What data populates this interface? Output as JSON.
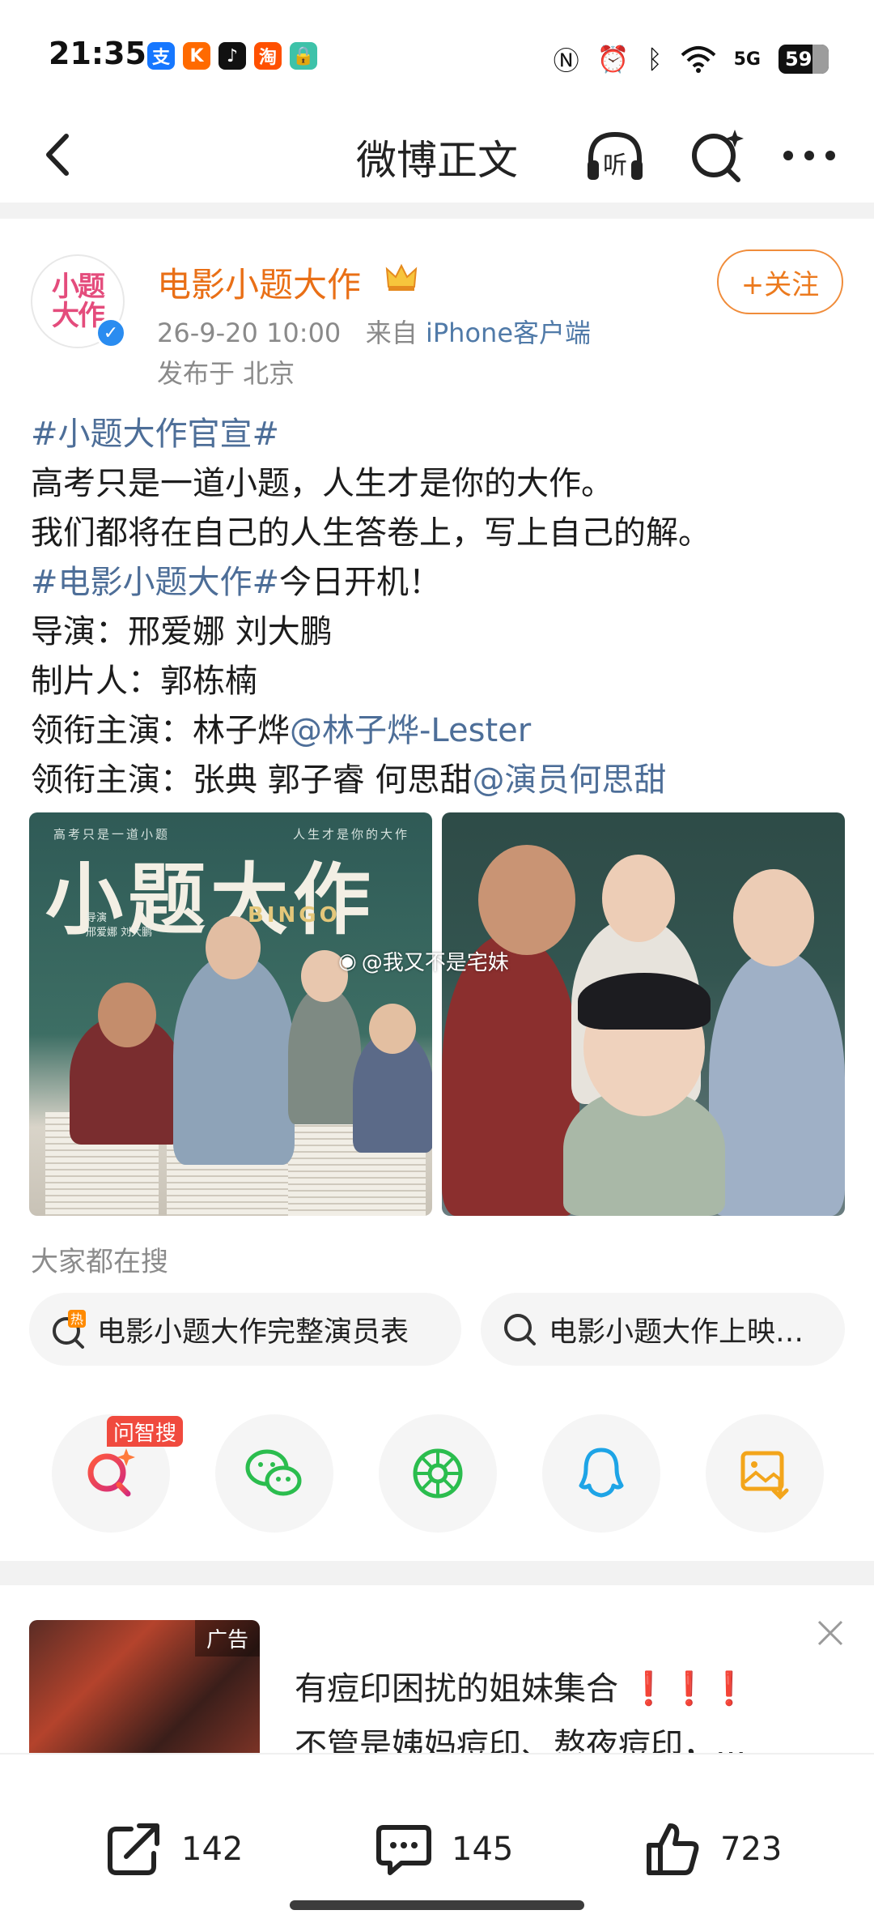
{
  "status_bar": {
    "time": "21:35",
    "apps": [
      {
        "icon": "alipay-icon",
        "glyph": "支",
        "color": "#1677ff"
      },
      {
        "icon": "kuaishou-icon",
        "glyph": "K",
        "color": "#ff6a00"
      },
      {
        "icon": "tiktok-icon",
        "glyph": "♪",
        "color": "#111111"
      },
      {
        "icon": "taobao-icon",
        "glyph": "淘",
        "color": "#ff5000"
      },
      {
        "icon": "lock-app-icon",
        "glyph": "🔒",
        "color": "#3ec2a9"
      }
    ],
    "network": "5G",
    "battery": "59"
  },
  "nav": {
    "title": "微博正文",
    "listen_label": "听"
  },
  "author": {
    "name": "电影小题大作",
    "avatar_text": "小题大作",
    "datetime": "26-9-20 10:00",
    "from_prefix": "来自",
    "source": "iPhone客户端",
    "location": "发布于 北京",
    "follow_label": "+关注"
  },
  "post": {
    "lines": [
      {
        "parts": [
          {
            "text": "#小题大作官宣#",
            "link": true
          }
        ]
      },
      {
        "parts": [
          {
            "text": "高考只是一道小题，人生才是你的大作。",
            "link": false
          }
        ]
      },
      {
        "parts": [
          {
            "text": "我们都将在自己的人生答卷上，写上自己的解。",
            "link": false
          }
        ]
      },
      {
        "parts": [
          {
            "text": "#电影小题大作#",
            "link": true
          },
          {
            "text": "今日开机！",
            "link": false
          }
        ]
      },
      {
        "parts": [
          {
            "text": "导演：邢爱娜 刘大鹏",
            "link": false
          }
        ]
      },
      {
        "parts": [
          {
            "text": "制片人：郭栋楠",
            "link": false
          }
        ]
      },
      {
        "parts": [
          {
            "text": "领衔主演：林子烨",
            "link": false
          },
          {
            "text": "@林子烨-Lester",
            "link": true
          }
        ]
      },
      {
        "parts": [
          {
            "text": "领衔主演：张典 郭子睿 何思甜",
            "link": false
          },
          {
            "text": "@演员何思甜",
            "link": true
          }
        ]
      }
    ]
  },
  "images": {
    "poster1": {
      "tagline_left": "高考只是一道小题",
      "tagline_right": "人生才是你的大作",
      "title": "小题大作",
      "subtitle": "BINGO",
      "director_label": "导演",
      "directors": "邢爱娜 刘大鹏"
    },
    "watermark": "@我又不是宅妹"
  },
  "search": {
    "label": "大家都在搜",
    "chips": [
      {
        "text": "电影小题大作完整演员表",
        "icon": "hot-search-icon"
      },
      {
        "text": "电影小题大作上映…",
        "icon": "search-icon"
      }
    ]
  },
  "share": {
    "ai_badge": "问智搜",
    "targets": [
      {
        "name": "ai-search-icon",
        "color": "#f04a3e"
      },
      {
        "name": "wechat-icon",
        "color": "#2bbd4e"
      },
      {
        "name": "moments-icon",
        "color": "#2bbd4e"
      },
      {
        "name": "qq-icon",
        "color": "#1ea4e6"
      },
      {
        "name": "save-image-icon",
        "color": "#f3a51b"
      }
    ]
  },
  "ad": {
    "tag": "广告",
    "title_text": "有痘印困扰的姐妹集合",
    "title_marks": "❗❗❗",
    "subtitle": "不管是姨妈痘印、熬夜痘印，..."
  },
  "actions": {
    "repost_count": "142",
    "comment_count": "145",
    "like_count": "723"
  }
}
